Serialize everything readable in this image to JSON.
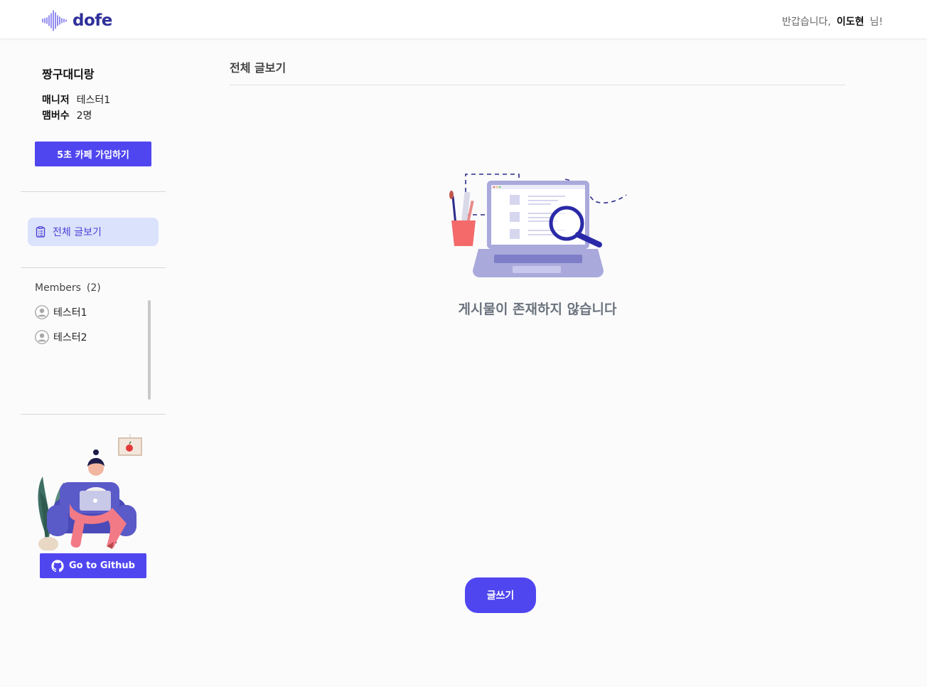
{
  "header": {
    "logo_text": "dofe",
    "greeting_prefix": "반갑습니다,",
    "user_name": "이도현",
    "greeting_suffix": "님!"
  },
  "sidebar": {
    "cafe_name": "짱구대디랑",
    "manager_label": "매니저",
    "manager_value": "테스터1",
    "member_count_label": "맴버수",
    "member_count_value": "2명",
    "join_button": "5초 카페 가입하기",
    "nav_all_posts": "전체 글보기",
    "members_title": "Members",
    "members_count": "(2)",
    "members": [
      {
        "name": "테스터1"
      },
      {
        "name": "테스터2"
      }
    ],
    "github_button": "Go to Github"
  },
  "main": {
    "title": "전체 글보기",
    "empty_message": "게시물이 존재하지 않습니다",
    "write_button": "글쓰기"
  },
  "colors": {
    "accent": "#5046f0",
    "nav_active_bg": "#dbe2fb",
    "empty_text": "#6b737d"
  },
  "icons": {
    "logo": "soundwave-icon",
    "nav": "clipboard-list-icon",
    "member": "user-avatar-icon",
    "github": "github-icon"
  }
}
